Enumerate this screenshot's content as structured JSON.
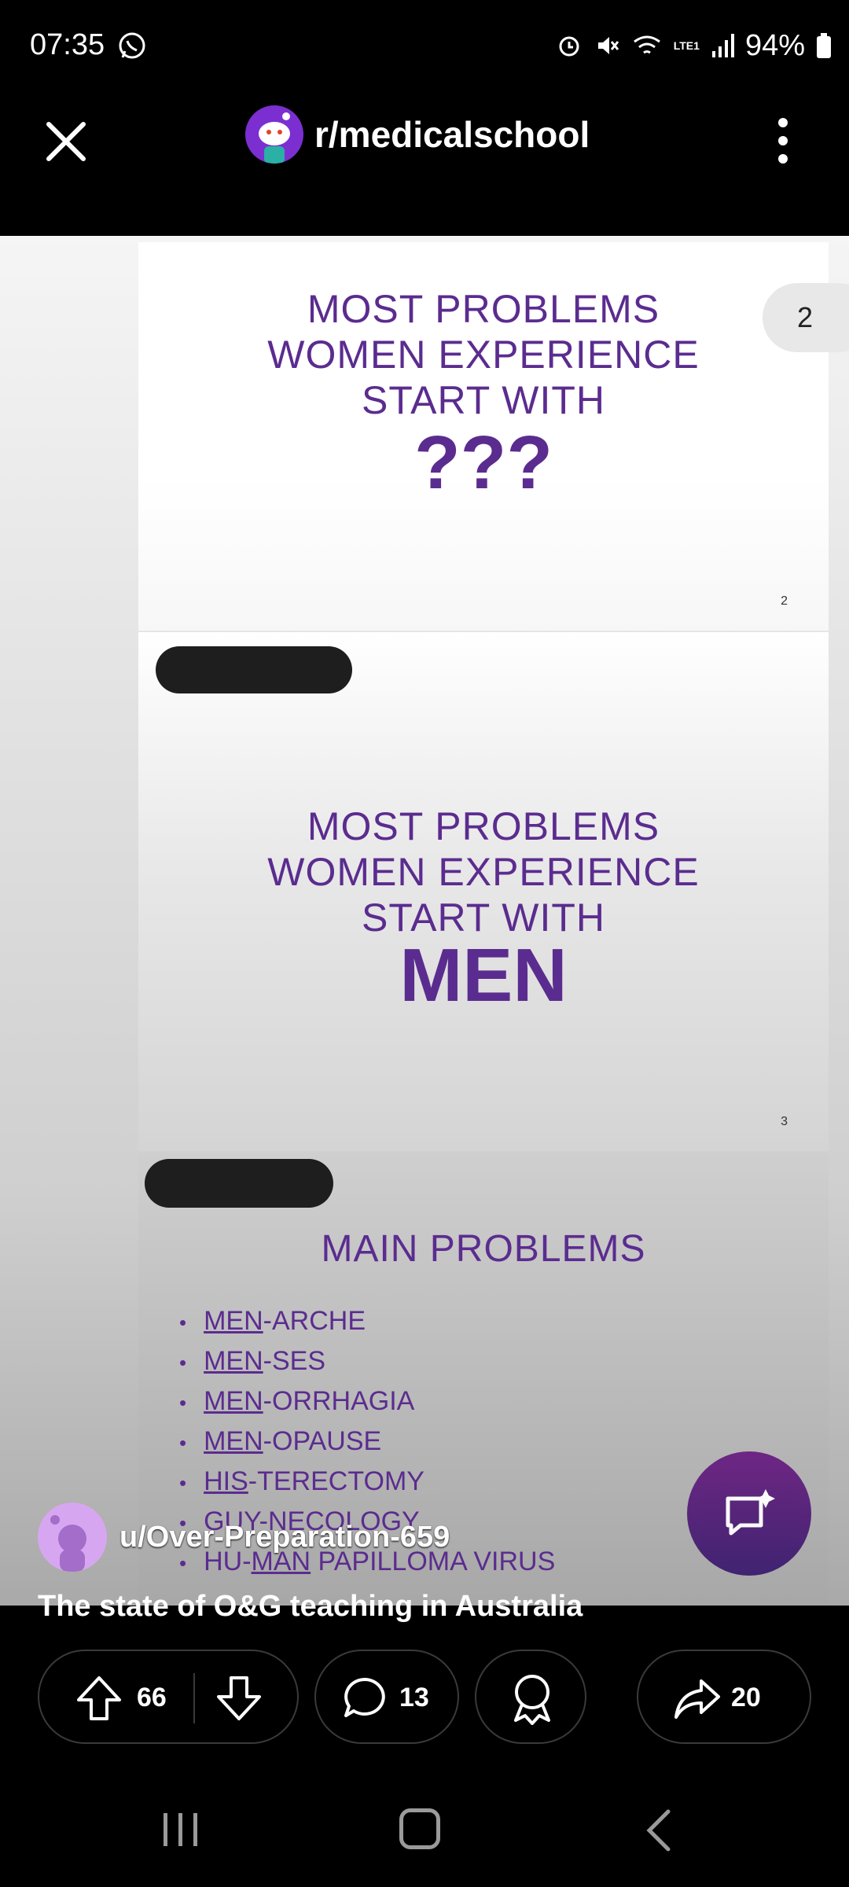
{
  "status_bar": {
    "time": "07:35",
    "battery": "94%",
    "network": "LTE1"
  },
  "header": {
    "subreddit": "r/medicalschool"
  },
  "image_counter": "2",
  "slides": [
    {
      "heading": "MOST PROBLEMS WOMEN EXPERIENCE START WITH",
      "big": "???",
      "page": "2"
    },
    {
      "heading": "MOST PROBLEMS WOMEN EXPERIENCE START WITH",
      "big": "MEN",
      "page": "3"
    },
    {
      "heading": "MAIN PROBLEMS",
      "items": [
        {
          "u": "MEN",
          "rest": "-ARCHE",
          "pre": ""
        },
        {
          "u": "MEN",
          "rest": "-SES",
          "pre": ""
        },
        {
          "u": "MEN",
          "rest": "-ORRHAGIA",
          "pre": ""
        },
        {
          "u": "MEN",
          "rest": "-OPAUSE",
          "pre": ""
        },
        {
          "u": "HIS",
          "rest": "-TERECTOMY",
          "pre": ""
        },
        {
          "u": "",
          "rest": "GUY-NECOLOGY",
          "pre": ""
        },
        {
          "u": "MAN",
          "rest": " PAPILLOMA VIRUS",
          "pre": "HU-"
        }
      ]
    }
  ],
  "post": {
    "author": "u/Over-Preparation-659",
    "title": "The state of O&G teaching in Australia"
  },
  "actions": {
    "upvotes": "66",
    "comments": "13",
    "shares": "20"
  },
  "colors": {
    "slide_text": "#5b2c8f",
    "fab": "#5a1f7e"
  }
}
